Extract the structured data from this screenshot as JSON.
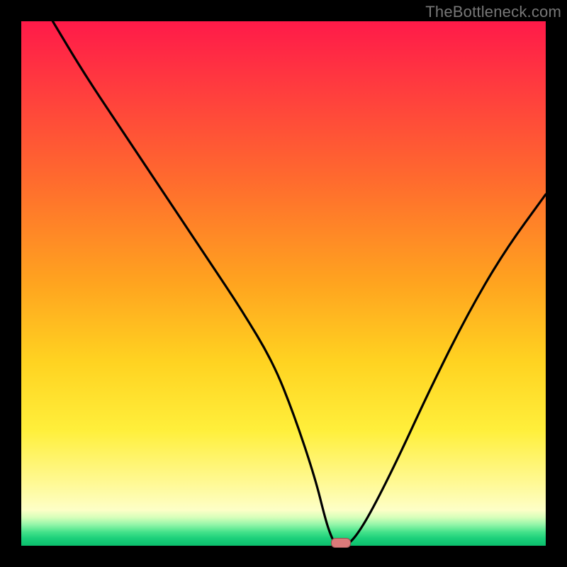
{
  "watermark": "TheBottleneck.com",
  "colors": {
    "page_bg": "#000000",
    "curve_stroke": "#000000",
    "trough_marker": "#db7a7a",
    "gradient_top": "#ff1a49",
    "gradient_mid1": "#ff6a2e",
    "gradient_mid2": "#ffd321",
    "gradient_mid3": "#fff994",
    "gradient_bottom": "#0bbf6d"
  },
  "chart_data": {
    "type": "line",
    "title": "",
    "xlabel": "",
    "ylabel": "",
    "xlim": [
      0,
      100
    ],
    "ylim": [
      0,
      100
    ],
    "grid": false,
    "legend": false,
    "series": [
      {
        "name": "bottleneck-curve",
        "x": [
          6,
          12,
          20,
          28,
          36,
          42,
          48,
          52,
          56,
          58,
          59,
          60,
          62,
          64,
          67,
          72,
          78,
          85,
          92,
          100
        ],
        "y": [
          100,
          90,
          78,
          66,
          54,
          45,
          35,
          25,
          13,
          5,
          2,
          0,
          0,
          2,
          7,
          17,
          30,
          44,
          56,
          67
        ]
      }
    ],
    "annotations": [
      {
        "name": "trough-marker",
        "x": 61,
        "y": 0,
        "shape": "pill",
        "color": "#db7a7a"
      }
    ],
    "background_gradient": {
      "direction": "vertical",
      "stops": [
        {
          "pos": 0.0,
          "color": "#ff1a49"
        },
        {
          "pos": 0.3,
          "color": "#ff6a2e"
        },
        {
          "pos": 0.65,
          "color": "#ffd321"
        },
        {
          "pos": 0.88,
          "color": "#fff994"
        },
        {
          "pos": 1.0,
          "color": "#0bbf6d"
        }
      ]
    }
  }
}
